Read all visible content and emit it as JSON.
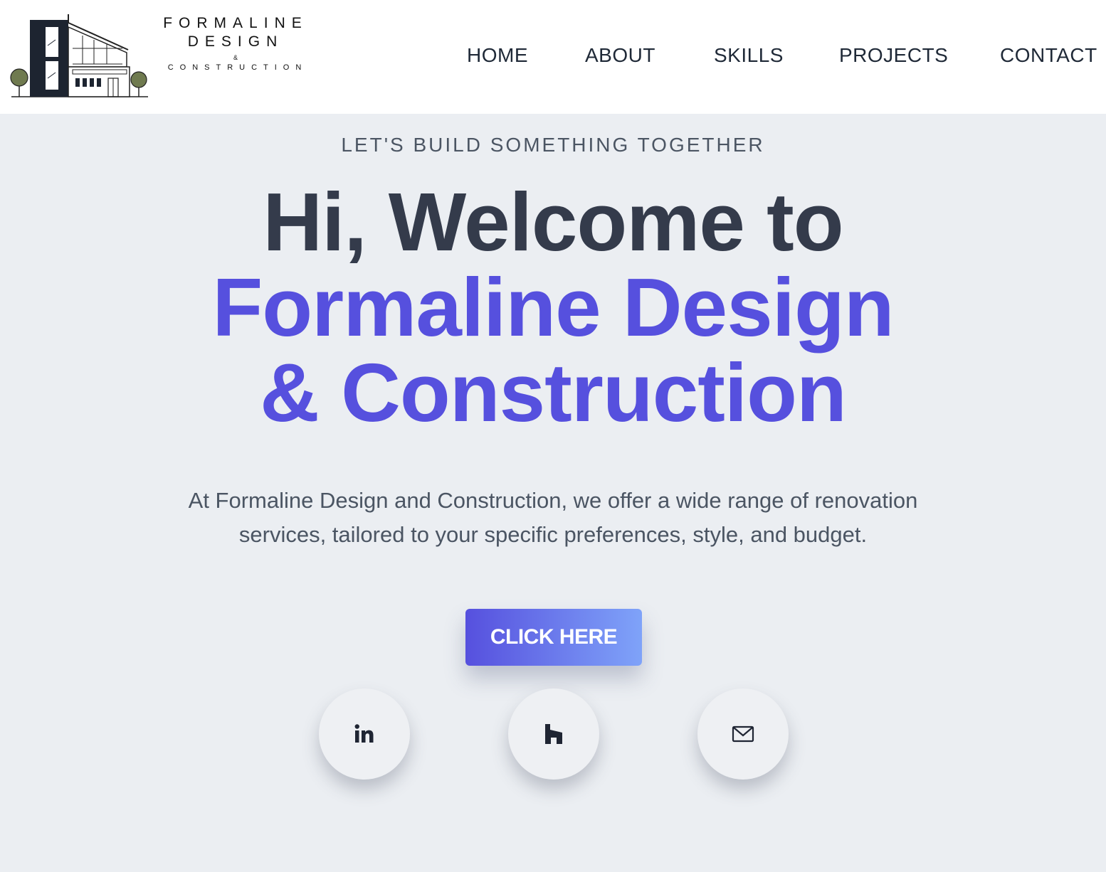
{
  "brand": {
    "line1": "FORMALINE",
    "line2": "DESIGN",
    "amp": "&",
    "line3": "CONSTRUCTION"
  },
  "nav": {
    "items": [
      "HOME",
      "ABOUT",
      "SKILLS",
      "PROJECTS",
      "CONTACT"
    ]
  },
  "hero": {
    "tagline": "LET'S BUILD SOMETHING TOGETHER",
    "title_line1": "Hi, Welcome to",
    "title_line2": "Formaline Design",
    "title_line3": "& Construction",
    "description": "At Formaline Design and Construction, we offer a wide range of renovation services, tailored to your specific preferences, style, and budget.",
    "cta_label": "CLICK HERE"
  },
  "social": {
    "icons": [
      "linkedin-icon",
      "houzz-icon",
      "mail-icon"
    ]
  },
  "colors": {
    "accent": "#5650de",
    "gradient_end": "#7fa3f9",
    "heading": "#343b4b",
    "hero_background": "#ebeef2"
  }
}
